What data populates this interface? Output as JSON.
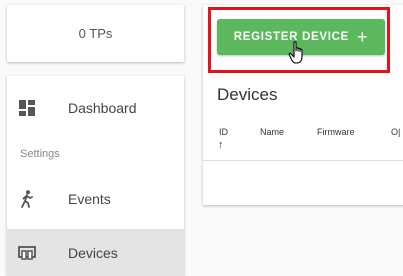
{
  "tp": {
    "count_label": "0 TPs"
  },
  "nav": {
    "dashboard_label": "Dashboard",
    "section_label": "Settings",
    "events_label": "Events",
    "devices_label": "Devices"
  },
  "main": {
    "register_label": "REGISTER DEVICE",
    "register_icon": "+",
    "title": "Devices",
    "columns": [
      "ID",
      "Name",
      "Firmware",
      "O|"
    ],
    "sort_indicator": "↑"
  },
  "colors": {
    "accent_green": "#5cb85c",
    "highlight_red": "#e3131b",
    "active_bg": "#e4e4e4"
  },
  "icons": [
    "dashboard-icon",
    "walking-person-icon",
    "devices-icon",
    "hand-pointer-cursor"
  ]
}
